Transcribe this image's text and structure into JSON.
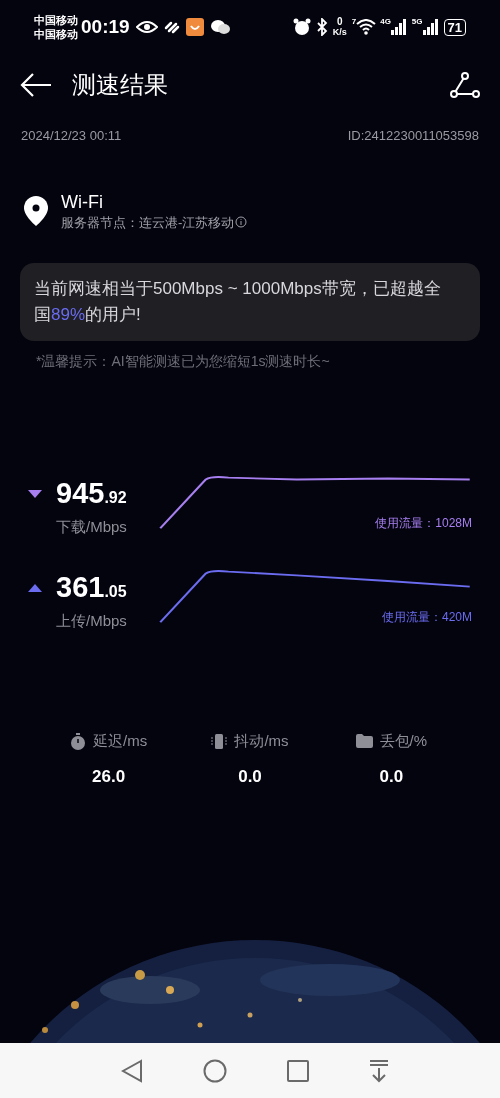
{
  "status_bar": {
    "carriers": [
      "中国移动",
      "中国移动"
    ],
    "time": "00:19",
    "net_speed": {
      "value": "0",
      "unit": "K/s"
    },
    "wifi_label": "7",
    "signals": [
      "4G",
      "5G"
    ],
    "battery": "71"
  },
  "header": {
    "title": "测速结果"
  },
  "meta": {
    "date": "2024/12/23 00:11",
    "id": "ID:2412230011053598"
  },
  "network": {
    "name": "Wi-Fi",
    "server": "服务器节点：连云港-江苏移动"
  },
  "summary": "当前网速相当于500Mbps ~ 1000Mbps带宽，已超越全国**89%**的用户!",
  "tip": "*温馨提示：AI智能测速已为您缩短1s测速时长~",
  "speeds": [
    {
      "kind": "download",
      "integer": "945",
      "decimal": ".92",
      "unit": "下载/Mbps",
      "usage": "使用流量：1028M",
      "color": "#a77ff0"
    },
    {
      "kind": "upload",
      "integer": "361",
      "decimal": ".05",
      "unit": "上传/Mbps",
      "usage": "使用流量：420M",
      "color": "#6b6cf0"
    }
  ],
  "stats": [
    {
      "kind": "latency",
      "label": "延迟/ms",
      "value": "26.0"
    },
    {
      "kind": "jitter",
      "label": "抖动/ms",
      "value": "0.0"
    },
    {
      "kind": "loss",
      "label": "丢包/%",
      "value": "0.0"
    }
  ]
}
